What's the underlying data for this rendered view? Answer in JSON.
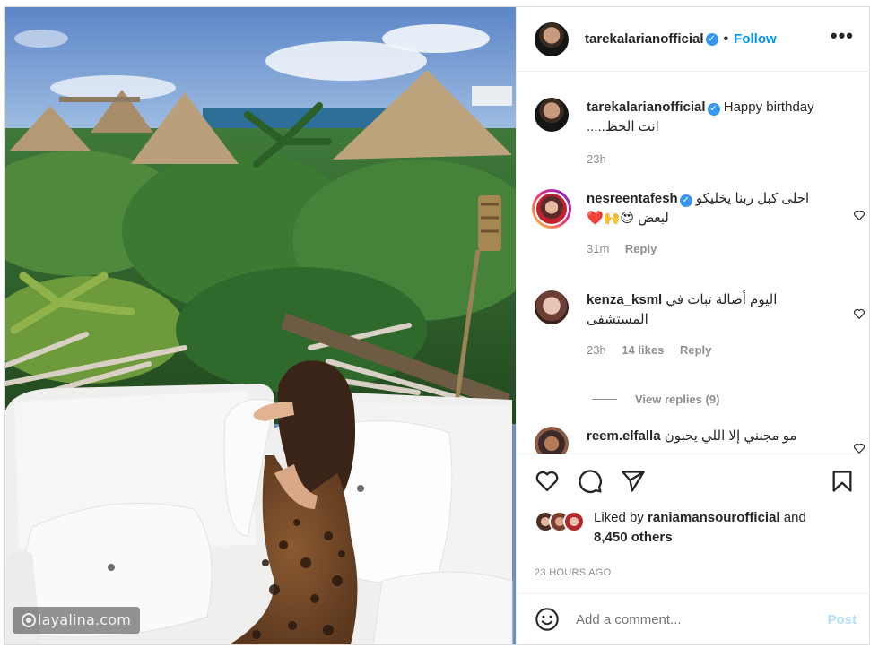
{
  "header": {
    "username": "tarekalarianofficial",
    "verified": true,
    "separator": "•",
    "follow_label": "Follow",
    "more_label": "•••"
  },
  "caption": {
    "username": "tarekalarianofficial",
    "line1": "Happy birthday",
    "line2": "انت الحظ.....",
    "time": "23h"
  },
  "comments": [
    {
      "username": "nesreentafesh",
      "verified": true,
      "line1": "احلى كبل ربنا يخليكو",
      "line2": "لبعض 😍🙌❤️",
      "time": "31m",
      "likes": "",
      "reply_label": "Reply"
    },
    {
      "username": "kenza_ksml",
      "verified": false,
      "line1": "اليوم أصالة تبات في",
      "line2": "المستشفى",
      "time": "23h",
      "likes": "14 likes",
      "reply_label": "Reply",
      "view_replies": "View replies (9)"
    },
    {
      "username": "reem.elfalla",
      "verified": false,
      "line1": "مو مجنني إلا اللي يحبون",
      "line2": ""
    }
  ],
  "likes": {
    "prefix": "Liked by",
    "user": "raniamansourofficial",
    "and": "and",
    "others": "8,450 others"
  },
  "timestamp": "23 HOURS AGO",
  "composer": {
    "placeholder": "Add a comment...",
    "post_label": "Post"
  },
  "watermark": "layalina.com",
  "colors": {
    "accent": "#0095f6",
    "verified": "#3897f0",
    "muted": "#8e8e8e",
    "post_disabled": "#b2dffc"
  },
  "icons": [
    "heart-icon",
    "comment-icon",
    "share-icon",
    "bookmark-icon",
    "emoji-icon",
    "more-icon",
    "verified-icon"
  ]
}
